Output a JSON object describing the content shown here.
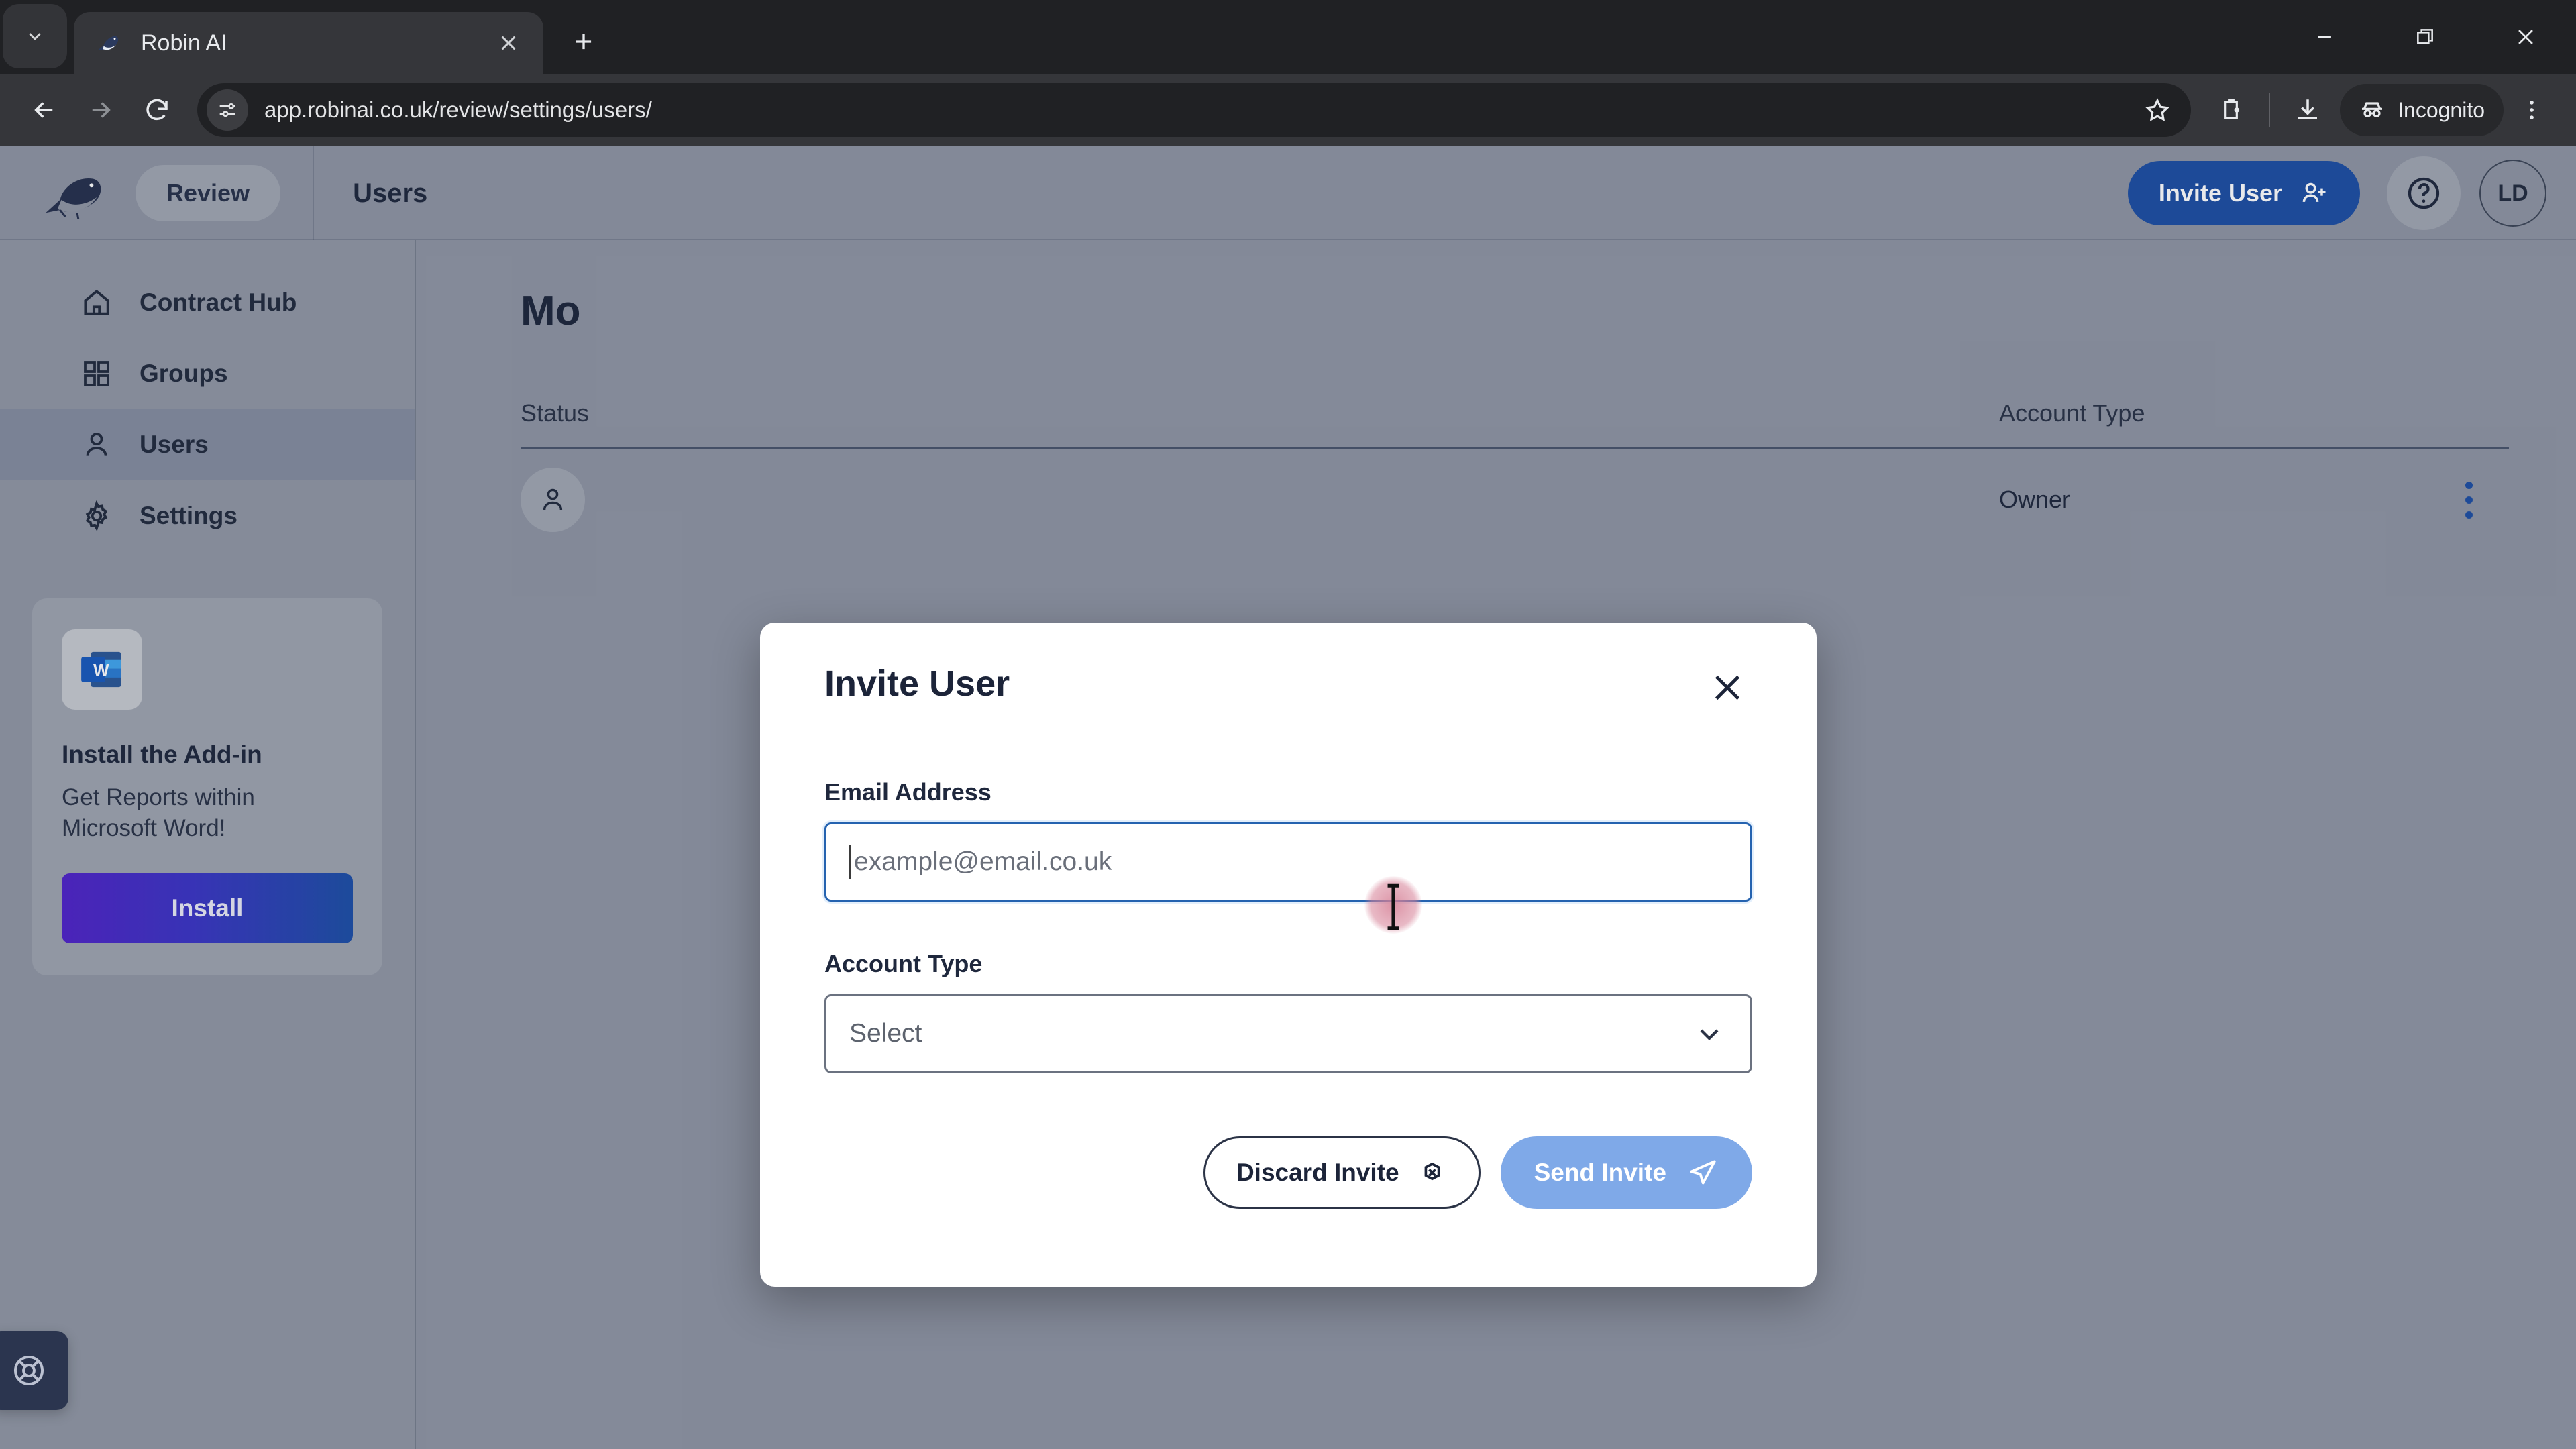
{
  "browser": {
    "tab": {
      "title": "Robin AI",
      "favicon": "robin-bird-icon"
    },
    "url": "app.robinai.co.uk/review/settings/users/",
    "incognito_label": "Incognito"
  },
  "appbar": {
    "review_label": "Review",
    "page_title": "Users",
    "invite_button": "Invite User",
    "avatar_initials": "LD"
  },
  "sidebar": {
    "items": [
      {
        "label": "Contract Hub",
        "icon": "home-icon",
        "active": false
      },
      {
        "label": "Groups",
        "icon": "grid-icon",
        "active": false
      },
      {
        "label": "Users",
        "icon": "user-icon",
        "active": true
      },
      {
        "label": "Settings",
        "icon": "gear-icon",
        "active": false
      }
    ],
    "promo": {
      "icon": "microsoft-word-icon",
      "title": "Install the Add-in",
      "subtitle": "Get Reports within Microsoft Word!",
      "button": "Install"
    },
    "support_icon": "lifebuoy-icon"
  },
  "main": {
    "heading": "Mo",
    "table": {
      "columns": [
        "Status",
        "",
        "Account Type",
        ""
      ],
      "rows": [
        {
          "avatar": "user-icon",
          "name": "",
          "account_type": "Owner",
          "actions": "kebab-icon"
        }
      ]
    }
  },
  "modal": {
    "title": "Invite User",
    "close_icon": "close-icon",
    "email": {
      "label": "Email Address",
      "value": "",
      "placeholder": "example@email.co.uk"
    },
    "account_type": {
      "label": "Account Type",
      "selected": "Select",
      "chevron": "chevron-down-icon"
    },
    "discard_button": "Discard Invite",
    "discard_icon": "circle-x-icon",
    "send_button": "Send Invite",
    "send_icon": "paper-plane-icon"
  },
  "colors": {
    "accent_blue": "#1e4fa3",
    "send_blue": "#7fa9e8",
    "page_bg": "#8f95a3",
    "sidebar_bg": "#9197a4",
    "sidebar_active": "#858da0",
    "text_dark": "#1f283d",
    "install_gradient_start": "#5123c8",
    "install_gradient_end": "#1d4fa6"
  }
}
